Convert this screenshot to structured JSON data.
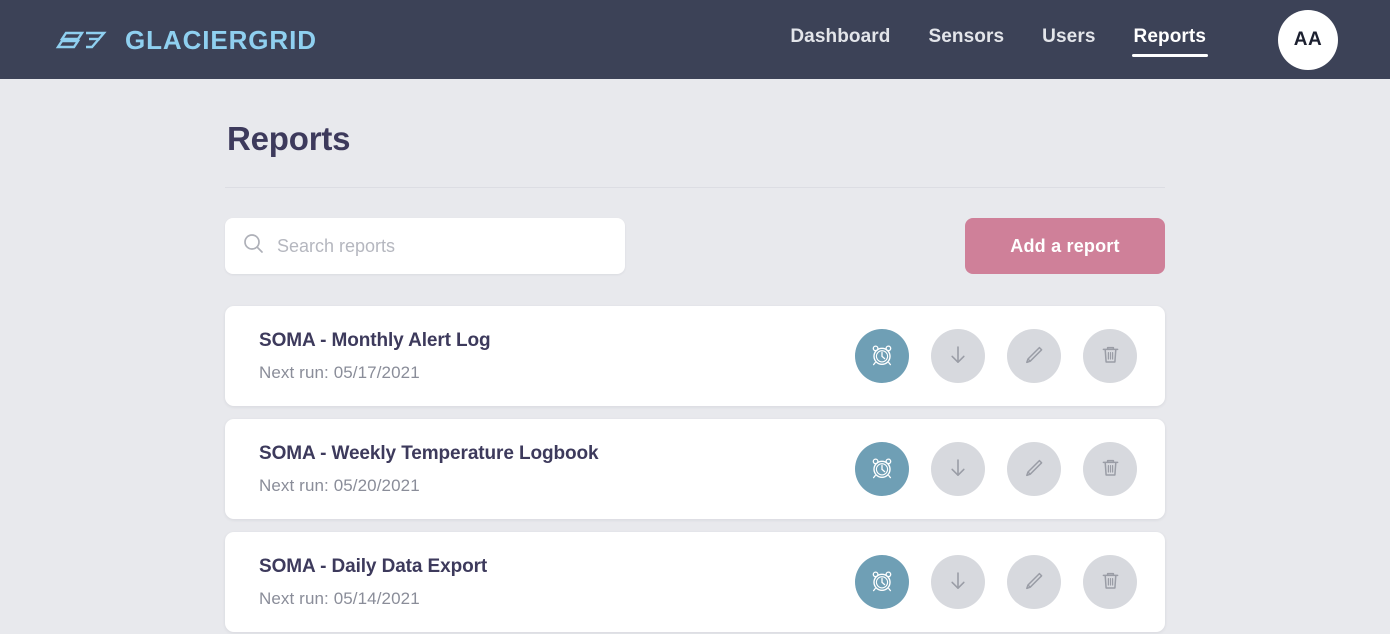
{
  "header": {
    "brand": {
      "name": "GLACIERGRID",
      "mark_icon": "glaciergrid-logo-mark",
      "color": "#8fd0f0"
    },
    "nav": [
      {
        "label": "Dashboard",
        "active": false
      },
      {
        "label": "Sensors",
        "active": false
      },
      {
        "label": "Users",
        "active": false
      },
      {
        "label": "Reports",
        "active": true
      }
    ],
    "avatar": {
      "initials": "AA"
    },
    "background_color": "#3c4257"
  },
  "main": {
    "title": "Reports",
    "search": {
      "placeholder": "Search reports",
      "value": "",
      "icon": "search-icon"
    },
    "add_button": {
      "label": "Add a report",
      "color": "#cf8099"
    },
    "action_icons": [
      {
        "name": "alarm-clock-icon",
        "label": "Schedule",
        "primary": true,
        "color": "#6f9fb5"
      },
      {
        "name": "download-arrow-icon",
        "label": "Download",
        "primary": false,
        "color": "#d7d9de"
      },
      {
        "name": "pencil-edit-icon",
        "label": "Edit",
        "primary": false,
        "color": "#d7d9de"
      },
      {
        "name": "trash-delete-icon",
        "label": "Delete",
        "primary": false,
        "color": "#d7d9de"
      }
    ],
    "reports": [
      {
        "name": "SOMA - Monthly Alert Log",
        "next_run": "Next run: 05/17/2021"
      },
      {
        "name": "SOMA - Weekly Temperature Logbook",
        "next_run": "Next run: 05/20/2021"
      },
      {
        "name": "SOMA - Daily Data Export",
        "next_run": "Next run: 05/14/2021"
      }
    ]
  },
  "page_background_color": "#e8e9ed"
}
